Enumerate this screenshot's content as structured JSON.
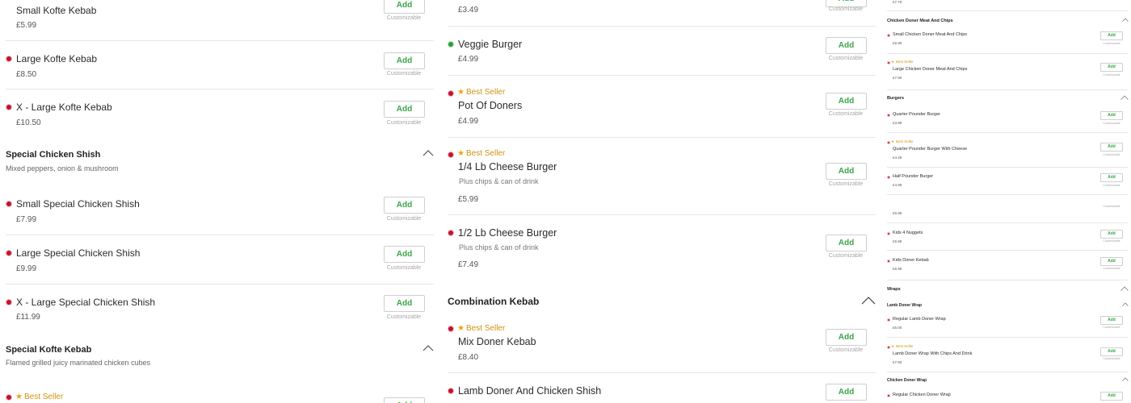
{
  "common": {
    "add_label": "Add",
    "customizable_label": "Customizable",
    "best_seller_label": "Best Seller"
  },
  "colors": {
    "add_text": "#3aa648",
    "best_seller": "#d19410",
    "non_veg_dot": "#c8102e",
    "veg_dot": "#2e9e3a"
  },
  "col1": {
    "items": [
      {
        "name": "Small Kofte Kebab",
        "price": "£5.99"
      },
      {
        "name": "Large Kofte Kebab",
        "price": "£8.50"
      },
      {
        "name": "X - Large Kofte Kebab",
        "price": "£10.50"
      }
    ],
    "section_special_chicken": {
      "title": "Special Chicken Shish",
      "subtitle": "Mixed peppers, onion & mushroom"
    },
    "items2": [
      {
        "name": "Small Special Chicken Shish",
        "price": "£7.99"
      },
      {
        "name": "Large Special Chicken Shish",
        "price": "£9.99"
      },
      {
        "name": "X - Large Special Chicken Shish",
        "price": "£11.99"
      }
    ],
    "section_special_kofte": {
      "title": "Special Kofte Kebab",
      "subtitle": "Flamed grilled juicy marinated chicken cubes"
    }
  },
  "col2": {
    "items": [
      {
        "price": "£3.49"
      },
      {
        "name": "Veggie Burger",
        "price": "£4.99"
      },
      {
        "name": "Pot Of Doners",
        "price": "£4.99"
      },
      {
        "name": "1/4 Lb Cheese Burger",
        "desc": "Plus chips & can of drink",
        "price": "£5.99"
      },
      {
        "name": "1/2 Lb Cheese Burger",
        "desc": "Plus chips & can of drink",
        "price": "£7.49"
      }
    ],
    "section_combination": {
      "title": "Combination Kebab"
    },
    "items2": [
      {
        "name": "Mix Doner Kebab",
        "price": "£8.40"
      },
      {
        "name": "Lamb Doner And Chicken Shish"
      }
    ]
  },
  "col3": {
    "top_price": "£7.70",
    "sec_chicken_meat_chips": "Chicken Doner Meat And Chips",
    "a1": {
      "name": "Small Chicken Doner Meat And Chips",
      "price": "£6.90"
    },
    "a2": {
      "name": "Large Chicken Doner Meat And Chips",
      "price": "£7.90"
    },
    "sec_burgers": "Burgers",
    "b1": {
      "name": "Quarter Pounder Burger",
      "price": "£3.99"
    },
    "b2": {
      "name": "Quarter Pounder Burger With Cheese",
      "price": "£4.49"
    },
    "b3": {
      "name": "Half Pounder Burger",
      "price": "£4.99"
    },
    "b4": {
      "price": "£5.99"
    },
    "b5": {
      "name": "Kids 4 Nuggets",
      "price": "£5.99"
    },
    "b6": {
      "name": "Kids Doner Kebab",
      "price": "£5.99"
    },
    "sec_wraps": "Wraps",
    "sub_lamb_wrap": "Lamb Doner Wrap",
    "w1": {
      "name": "Regular Lamb Doner Wrap",
      "price": "£6.00"
    },
    "w2": {
      "name": "Lamb Doner Wrap With Chips And Drink",
      "price": "£7.90"
    },
    "sub_chicken_wrap": "Chicken Doner Wrap",
    "w3": {
      "name": "Regular Chicken Doner Wrap"
    }
  }
}
